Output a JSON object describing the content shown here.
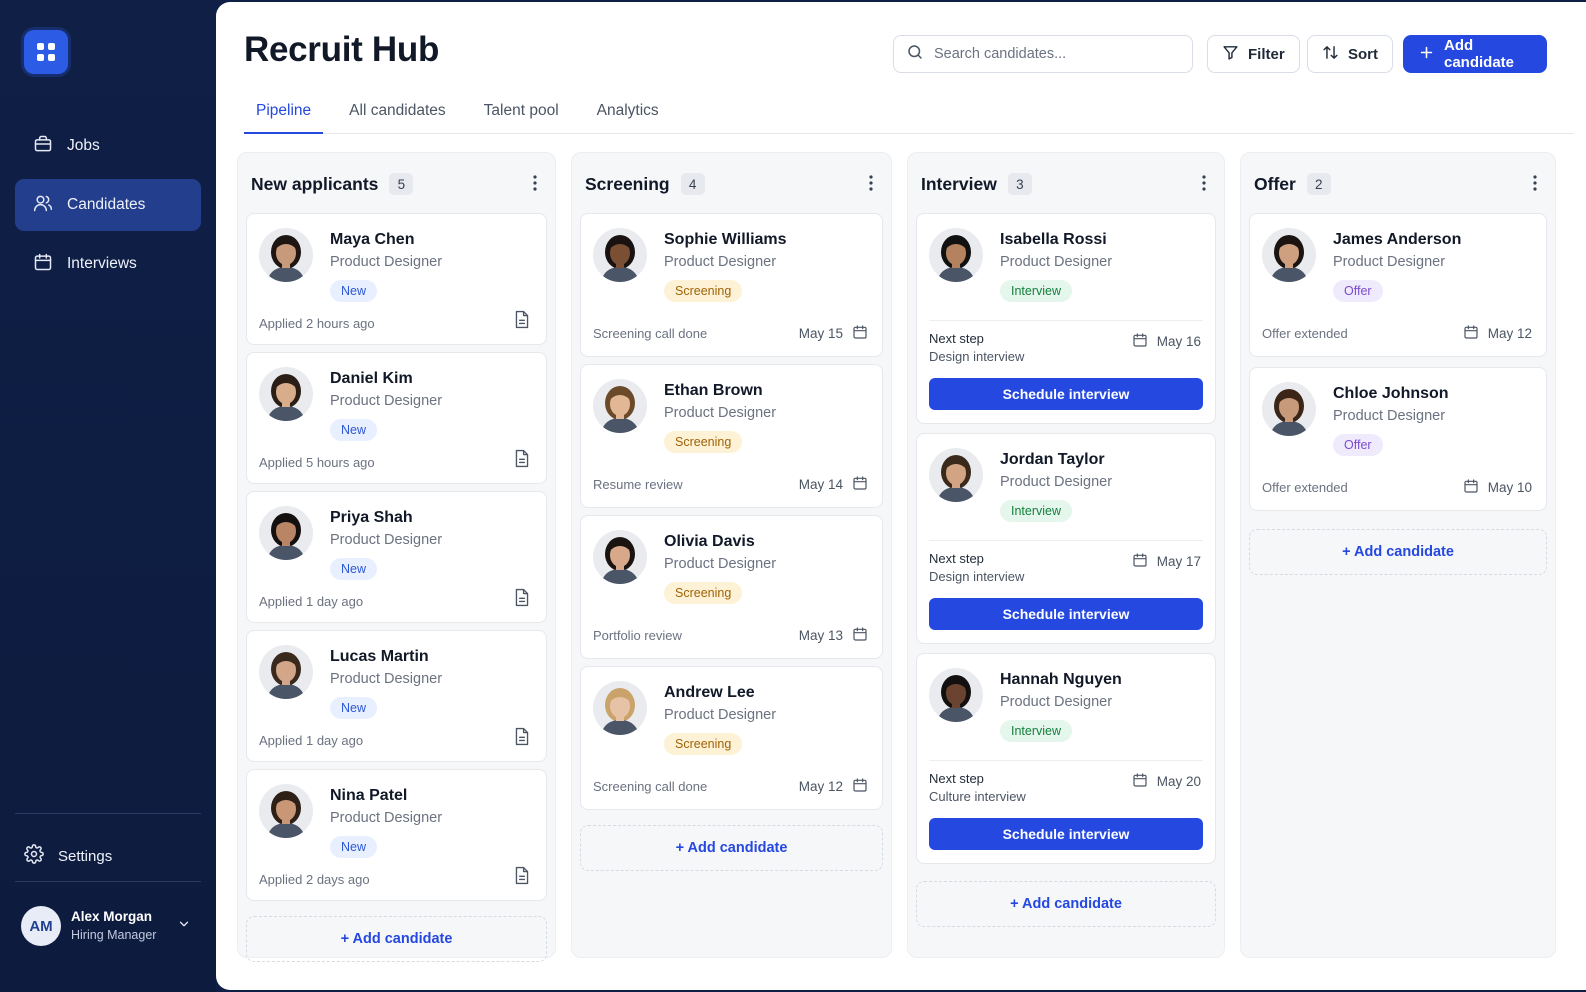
{
  "app": {
    "title": "Recruit Hub"
  },
  "sidebar": {
    "items": [
      {
        "label": "Jobs",
        "icon": "briefcase-icon",
        "active": false
      },
      {
        "label": "Candidates",
        "icon": "users-icon",
        "active": true
      },
      {
        "label": "Interviews",
        "icon": "calendar-icon",
        "active": false
      }
    ],
    "settings_label": "Settings",
    "user": {
      "initials": "AM",
      "name": "Alex Morgan",
      "role": "Hiring Manager"
    }
  },
  "header": {
    "search_placeholder": "Search candidates...",
    "filter_label": "Filter",
    "sort_label": "Sort",
    "add_label": "Add candidate"
  },
  "tabs": [
    {
      "label": "Pipeline",
      "active": true
    },
    {
      "label": "All candidates",
      "active": false
    },
    {
      "label": "Talent pool",
      "active": false
    },
    {
      "label": "Analytics",
      "active": false
    }
  ],
  "colors": {
    "accent": "#2448e0",
    "sidebar": "#0f1f46",
    "new": "#2c58d6",
    "screening": "#a16207",
    "interview": "#15803d",
    "offer": "#7c4cd0"
  },
  "add_candidate_label": "+ Add candidate",
  "schedule_label": "Schedule interview",
  "next_step_label": "Next step",
  "columns": [
    {
      "title": "New applicants",
      "count": "5",
      "cards": [
        {
          "name": "Maya Chen",
          "role": "Product Designer",
          "badge": "New",
          "foot": "Applied 2 hours ago"
        },
        {
          "name": "Daniel Kim",
          "role": "Product Designer",
          "badge": "New",
          "foot": "Applied 5 hours ago"
        },
        {
          "name": "Priya Shah",
          "role": "Product Designer",
          "badge": "New",
          "foot": "Applied 1 day ago"
        },
        {
          "name": "Lucas Martin",
          "role": "Product Designer",
          "badge": "New",
          "foot": "Applied 1 day ago"
        },
        {
          "name": "Nina Patel",
          "role": "Product Designer",
          "badge": "New",
          "foot": "Applied 2 days ago"
        }
      ]
    },
    {
      "title": "Screening",
      "count": "4",
      "cards": [
        {
          "name": "Sophie Williams",
          "role": "Product Designer",
          "badge": "Screening",
          "foot": "Screening call done",
          "date": "May 15"
        },
        {
          "name": "Ethan Brown",
          "role": "Product Designer",
          "badge": "Screening",
          "foot": "Resume review",
          "date": "May 14"
        },
        {
          "name": "Olivia Davis",
          "role": "Product Designer",
          "badge": "Screening",
          "foot": "Portfolio review",
          "date": "May 13"
        },
        {
          "name": "Andrew Lee",
          "role": "Product Designer",
          "badge": "Screening",
          "foot": "Screening call done",
          "date": "May 12"
        }
      ]
    },
    {
      "title": "Interview",
      "count": "3",
      "cards": [
        {
          "name": "Isabella Rossi",
          "role": "Product Designer",
          "badge": "Interview",
          "step": "Design interview",
          "date": "May 16"
        },
        {
          "name": "Jordan Taylor",
          "role": "Product Designer",
          "badge": "Interview",
          "step": "Design interview",
          "date": "May 17"
        },
        {
          "name": "Hannah Nguyen",
          "role": "Product Designer",
          "badge": "Interview",
          "step": "Culture interview",
          "date": "May 20"
        }
      ]
    },
    {
      "title": "Offer",
      "count": "2",
      "cards": [
        {
          "name": "James Anderson",
          "role": "Product Designer",
          "badge": "Offer",
          "foot": "Offer extended",
          "date": "May 12"
        },
        {
          "name": "Chloe Johnson",
          "role": "Product Designer",
          "badge": "Offer",
          "foot": "Offer extended",
          "date": "May 10"
        }
      ]
    }
  ]
}
